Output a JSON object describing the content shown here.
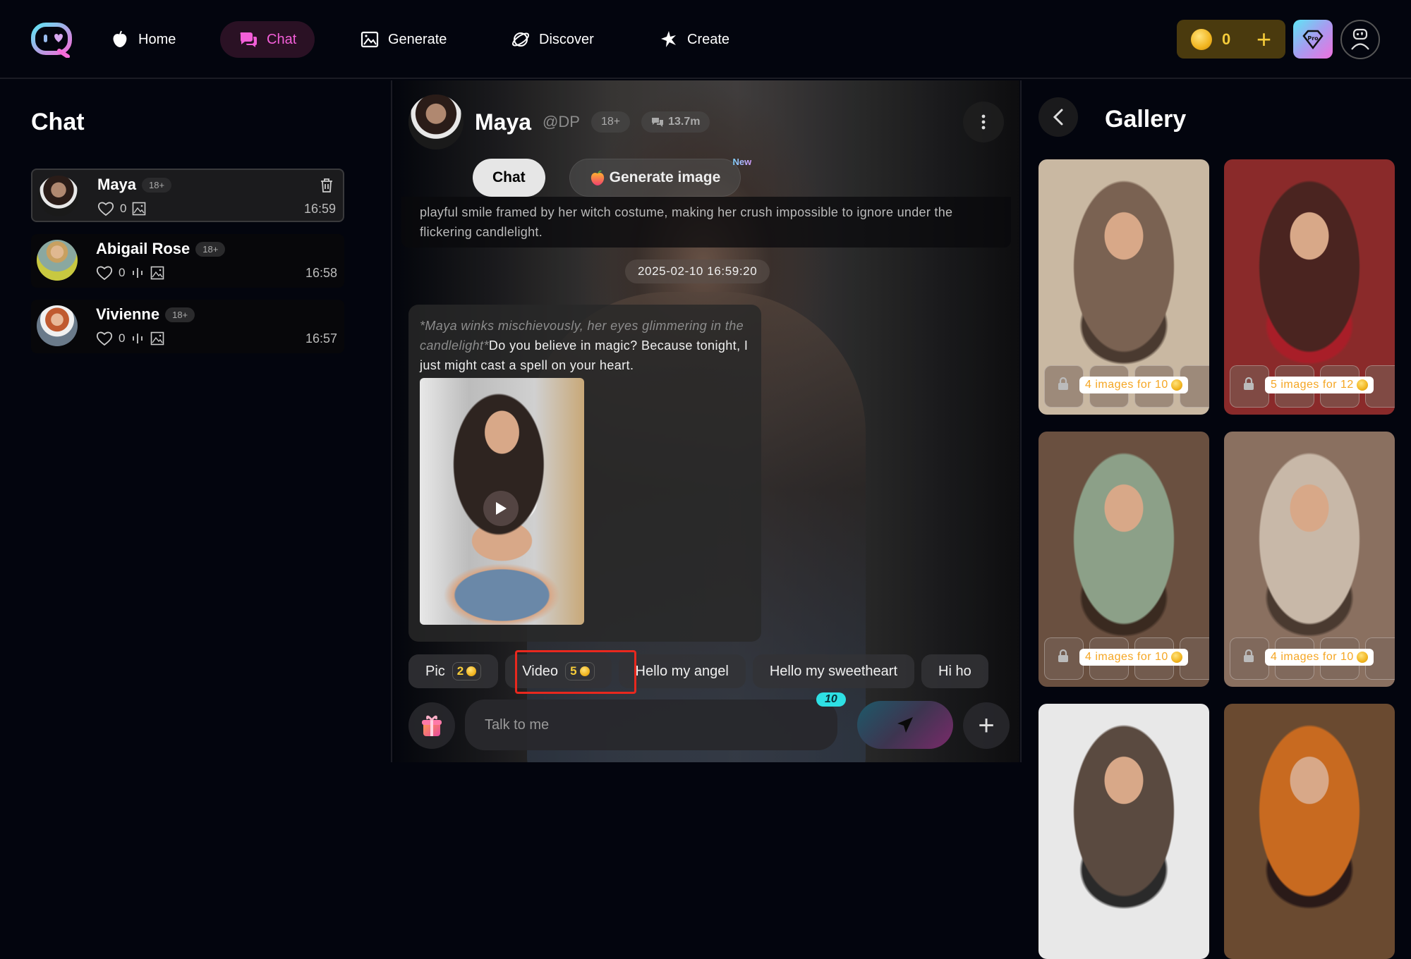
{
  "nav": {
    "items": [
      {
        "label": "Home",
        "icon": "peach-icon"
      },
      {
        "label": "Chat",
        "icon": "chat-bubbles-icon",
        "active": true
      },
      {
        "label": "Generate",
        "icon": "image-icon"
      },
      {
        "label": "Discover",
        "icon": "planet-icon"
      },
      {
        "label": "Create",
        "icon": "sparkle-icon"
      }
    ],
    "coins": "0",
    "coin_plus": "+",
    "pro_label": "Pro",
    "accent": "#f35fd8"
  },
  "sidebar": {
    "title": "Chat",
    "chats": [
      {
        "name": "Maya",
        "badge": "18+",
        "likes": "0",
        "time": "16:59",
        "active": true
      },
      {
        "name": "Abigail Rose",
        "badge": "18+",
        "likes": "0",
        "time": "16:58"
      },
      {
        "name": "Vivienne",
        "badge": "18+",
        "likes": "0",
        "time": "16:57"
      }
    ]
  },
  "character": {
    "name": "Maya",
    "handle": "@DP",
    "badge": "18+",
    "chats_count": "13.7m",
    "tabs": [
      {
        "label": "Chat",
        "active": true
      },
      {
        "label": "Generate image",
        "tag": "New"
      }
    ],
    "description": "playful smile framed by her witch costume, making her crush impossible to ignore under the flickering candlelight."
  },
  "conversation": {
    "timestamp": "2025-02-10 16:59:20",
    "message": {
      "action": "*Maya winks mischievously, her eyes glimmering in the candlelight*",
      "text": "Do you believe in magic? Because tonight, I just might cast a spell on your heart.",
      "media_type": "video"
    }
  },
  "quick_actions": [
    {
      "label": "Pic",
      "cost": "2"
    },
    {
      "label": "Video",
      "cost": "5",
      "highlighted": true
    },
    {
      "label": "Hello my angel"
    },
    {
      "label": "Hello my sweetheart"
    },
    {
      "label": "Hi ho"
    }
  ],
  "composer": {
    "placeholder": "Talk to me",
    "remaining": "10",
    "plus": "+"
  },
  "gallery": {
    "title": "Gallery",
    "items": [
      {
        "price": "4 images for 10",
        "tones": [
          "#c9b8a2",
          "#7a6252",
          "#4a3a30"
        ]
      },
      {
        "price": "5 images for 12",
        "tones": [
          "#8a2a2a",
          "#4a2420",
          "#a81e28"
        ]
      },
      {
        "price": "4 images for 10",
        "tones": [
          "#6a5040",
          "#8ca088",
          "#3a2a20"
        ]
      },
      {
        "price": "4 images for 10",
        "tones": [
          "#8a7060",
          "#c8b8a8",
          "#4a3a30"
        ]
      },
      {
        "price": "",
        "tones": [
          "#e8e8e8",
          "#5a4a40",
          "#2a2a2a"
        ]
      },
      {
        "price": "",
        "tones": [
          "#6a4a30",
          "#c86a20",
          "#2a1a18"
        ]
      }
    ]
  }
}
